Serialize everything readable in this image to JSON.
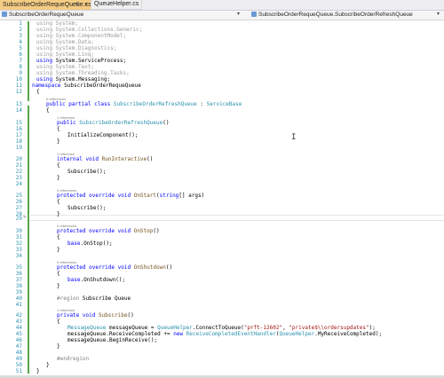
{
  "tabs": {
    "active_label": "SubscribeOrderRequeQueue.cs",
    "active_pin": "⊕",
    "active_close": "×",
    "inactive_label": "QueueHelper.cs"
  },
  "nav": {
    "project": "SubscribeOrderRequeQueue",
    "member": "SubscribeOrderRequeQueue.SubscribeOrderRefreshQueue"
  },
  "lens": {
    "refs0": "0 references",
    "refs1": "1 reference"
  },
  "code": {
    "l1": "using System;",
    "l2": "using System.Collections.Generic;",
    "l3": "using System.ComponentModel;",
    "l4": "using System.Data;",
    "l5": "using System.Diagnostics;",
    "l6": "using System.Linq;",
    "l7a": "using ",
    "l7b": "System.ServiceProcess;",
    "l8": "using System.Text;",
    "l9": "using System.Threading.Tasks;",
    "l10a": "using ",
    "l10b": "System.Messaging;",
    "l11a": "namespace ",
    "l11b": "SubscribeOrderRequeQueue",
    "brace_open": "{",
    "brace_close": "}",
    "l13a": "public partial class ",
    "l13b": "SubscribeOrderRefreshQueue",
    "l13c": " : ",
    "l13d": "ServiceBase",
    "l15a": "public ",
    "l15b": "SubscribeOrderRefreshQueue",
    "l15c": "()",
    "l17": "InitializeComponent();",
    "l20a": "internal void ",
    "l20b": "RunInteractive",
    "l20c": "()",
    "l22": "Subscribe();",
    "l25a": "protected override void ",
    "l25b": "OnStart",
    "l25c": "(",
    "l25d": "string",
    "l25e": "[] args)",
    "l30a": "protected override void ",
    "l30b": "OnStop",
    "l30c": "()",
    "l32a": "base",
    "l32b": ".OnStop();",
    "l35a": "protected override void ",
    "l35b": "OnShutdown",
    "l35c": "()",
    "l37a": "base",
    "l37b": ".OnShutdown();",
    "l40a": "#region ",
    "l40b": "Subscribe Queue",
    "l42a": "private void ",
    "l42b": "Subscribe",
    "l42c": "()",
    "l44a": "MessageQueue",
    "l44b": " messageQueue = ",
    "l44c": "QueueHelper",
    "l44d": ".ConnectToQueue(",
    "l44e": "\"prft-12602\"",
    "l44f": ", ",
    "l44g": "\"private$\\\\ordersupdates\"",
    "l44h": ");",
    "l45a": "messageQueue.ReceiveCompleted += ",
    "l45b": "new ",
    "l45c": "ReceiveCompletedEventHandler",
    "l45d": "(",
    "l45e": "QueueHelper",
    "l45f": ".MyReceiveCompleted);",
    "l46": "messageQueue.BeginReceive();",
    "l49": "#endregion"
  },
  "line_numbers": [
    "1",
    "2",
    "3",
    "4",
    "5",
    "6",
    "7",
    "8",
    "9",
    "10",
    "11",
    "12",
    "13",
    "14",
    "15",
    "16",
    "17",
    "18",
    "19",
    "20",
    "21",
    "22",
    "23",
    "24",
    "25",
    "26",
    "27",
    "28",
    "29",
    "30",
    "31",
    "32",
    "33",
    "34",
    "35",
    "36",
    "37",
    "38",
    "39",
    "40",
    "41",
    "42",
    "43",
    "44",
    "45",
    "46",
    "47",
    "48",
    "49",
    "50",
    "51"
  ],
  "icons": [
    "pencil-icon",
    "ibeam-cursor-icon",
    "pin-icon",
    "close-icon",
    "chevron-down-icon",
    "class-icon"
  ]
}
